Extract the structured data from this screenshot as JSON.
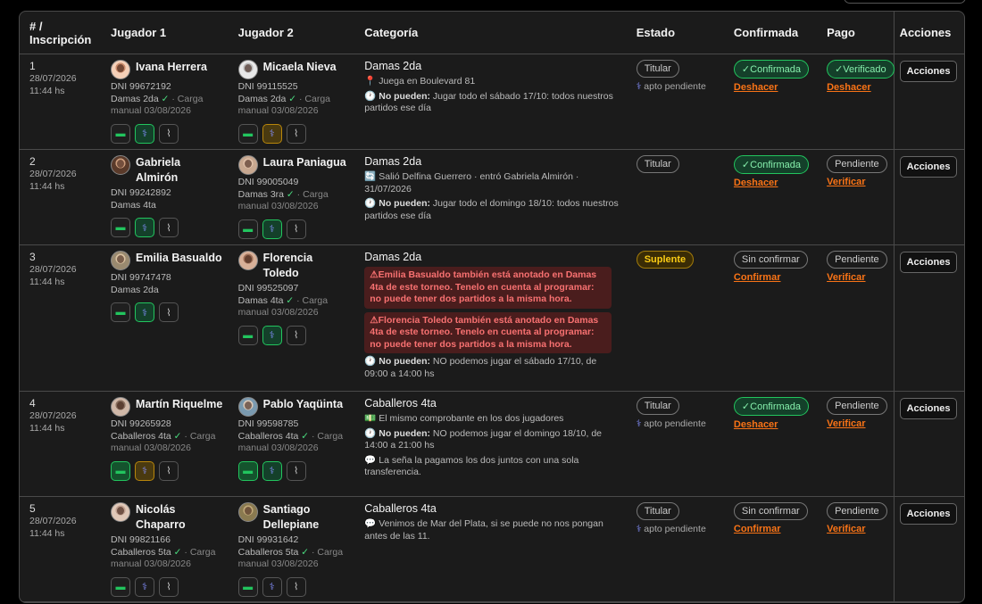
{
  "headers": {
    "num": "# /",
    "num2": "Inscripción",
    "p1": "Jugador 1",
    "p2": "Jugador 2",
    "cat": "Categoría",
    "estado": "Estado",
    "conf": "Confirmada",
    "pago": "Pago",
    "acc": "Acciones"
  },
  "rows": [
    {
      "num": "1",
      "date": "28/07/2026",
      "time": "11:44 hs",
      "p1": {
        "name": "Ivana Herrera",
        "dni": "DNI 99672192",
        "cat": "Damas 2da",
        "check": "✓",
        "extra": "· Carga manual 03/08/2026"
      },
      "p2": {
        "name": "Micaela Nieva",
        "dni": "DNI 99115525",
        "cat": "Damas 2da",
        "check": "✓",
        "extra": "· Carga manual 03/08/2026"
      },
      "category": "Damas 2da",
      "notes": [
        {
          "icon": "📍",
          "bold": "",
          "text": "Juega en Boulevard 81"
        },
        {
          "icon": "🕐",
          "bold": "No pueden:",
          "text": "Jugar todo el sábado 17/10: todos nuestros partidos ese día"
        }
      ],
      "warnings": [],
      "estado": "Titular",
      "apto": "apto pendiente",
      "conf": "✓Confirmada",
      "conf_link": "Deshacer",
      "pago": "✓Verificado",
      "pago_link": "Deshacer",
      "accion": "Acciones"
    },
    {
      "num": "2",
      "date": "28/07/2026",
      "time": "11:44 hs",
      "p1": {
        "name": "Gabriela Almirón",
        "dni": "DNI 99242892",
        "cat": "Damas 4ta",
        "check": "",
        "extra": ""
      },
      "p2": {
        "name": "Laura Paniagua",
        "dni": "DNI 99005049",
        "cat": "Damas 3ra",
        "check": "✓",
        "extra": "· Carga manual 03/08/2026"
      },
      "category": "Damas 2da",
      "notes": [
        {
          "icon": "🔄",
          "bold": "",
          "text": "Salió Delfina Guerrero · entró Gabriela Almirón · 31/07/2026"
        },
        {
          "icon": "🕐",
          "bold": "No pueden:",
          "text": "Jugar todo el domingo 18/10: todos nuestros partidos ese día"
        }
      ],
      "warnings": [],
      "estado": "Titular",
      "apto": "",
      "conf": "✓Confirmada",
      "conf_link": "Deshacer",
      "pago": "Pendiente",
      "pago_link": "Verificar",
      "accion": "Acciones"
    },
    {
      "num": "3",
      "date": "28/07/2026",
      "time": "11:44 hs",
      "p1": {
        "name": "Emilia Basualdo",
        "dni": "DNI 99747478",
        "cat": "Damas 2da",
        "check": "",
        "extra": ""
      },
      "p2": {
        "name": "Florencia Toledo",
        "dni": "DNI 99525097",
        "cat": "Damas 4ta",
        "check": "✓",
        "extra": "· Carga manual 03/08/2026"
      },
      "category": "Damas 2da",
      "warnings": [
        "⚠Emilia Basualdo también está anotado en Damas 4ta de este torneo. Tenelo en cuenta al programar: no puede tener dos partidos a la misma hora.",
        "⚠Florencia Toledo también está anotado en Damas 4ta de este torneo. Tenelo en cuenta al programar: no puede tener dos partidos a la misma hora."
      ],
      "notes": [
        {
          "icon": "🕐",
          "bold": "No pueden:",
          "text": "NO podemos jugar el sábado 17/10, de 09:00 a 14:00 hs"
        }
      ],
      "estado": "Suplente",
      "apto": "",
      "conf": "Sin confirmar",
      "conf_link": "Confirmar",
      "pago": "Pendiente",
      "pago_link": "Verificar",
      "accion": "Acciones"
    },
    {
      "num": "4",
      "date": "28/07/2026",
      "time": "11:44 hs",
      "p1": {
        "name": "Martín Riquelme",
        "dni": "DNI 99265928",
        "cat": "Caballeros 4ta",
        "check": "✓",
        "extra": "· Carga manual 03/08/2026"
      },
      "p2": {
        "name": "Pablo Yaqüinta",
        "dni": "DNI 99598785",
        "cat": "Caballeros 4ta",
        "check": "✓",
        "extra": "· Carga manual 03/08/2026"
      },
      "category": "Caballeros 4ta",
      "notes": [
        {
          "icon": "💵",
          "bold": "",
          "text": "El mismo comprobante en los dos jugadores"
        },
        {
          "icon": "🕐",
          "bold": "No pueden:",
          "text": "NO podemos jugar el domingo 18/10, de 14:00 a 21:00 hs"
        },
        {
          "icon": "💬",
          "bold": "",
          "text": "La seña la pagamos los dos juntos con una sola transferencia."
        }
      ],
      "warnings": [],
      "estado": "Titular",
      "apto": "apto pendiente",
      "conf": "✓Confirmada",
      "conf_link": "Deshacer",
      "pago": "Pendiente",
      "pago_link": "Verificar",
      "accion": "Acciones"
    },
    {
      "num": "5",
      "date": "28/07/2026",
      "time": "11:44 hs",
      "p1": {
        "name": "Nicolás Chaparro",
        "dni": "DNI 99821166",
        "cat": "Caballeros 5ta",
        "check": "✓",
        "extra": "· Carga manual 03/08/2026"
      },
      "p2": {
        "name": "Santiago Dellepiane",
        "dni": "DNI 99931642",
        "cat": "Caballeros 5ta",
        "check": "✓",
        "extra": "· Carga manual 03/08/2026"
      },
      "category": "Caballeros 4ta",
      "notes": [
        {
          "icon": "💬",
          "bold": "",
          "text": "Venimos de Mar del Plata, si se puede no nos pongan antes de las 11."
        }
      ],
      "warnings": [],
      "estado": "Titular",
      "apto": "apto pendiente",
      "conf": "Sin confirmar",
      "conf_link": "Confirmar",
      "pago": "Pendiente",
      "pago_link": "Verificar",
      "accion": "Acciones"
    }
  ],
  "colors": {
    "accent": "#f97316",
    "ok": "#22c55e",
    "warn_bg": "#4a1d1d",
    "warn_text": "#f87171",
    "suplente": "#facc15"
  },
  "icons": {
    "cash": "cash-icon",
    "med": "medical-icon",
    "clip": "paperclip-icon",
    "pin": "pin-icon",
    "clock": "clock-icon",
    "swap": "swap-icon",
    "chat": "chat-icon"
  }
}
